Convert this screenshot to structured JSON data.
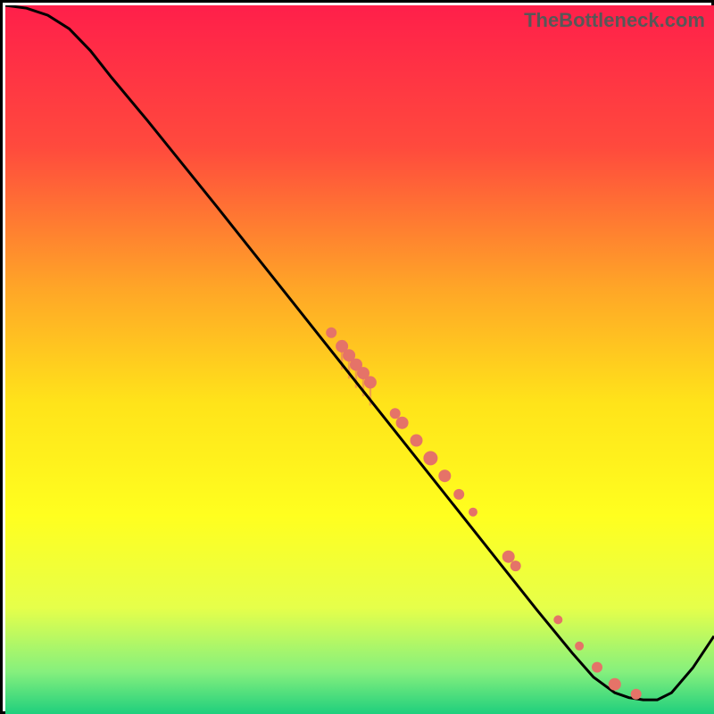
{
  "watermark": "TheBottleneck.com",
  "chart_data": {
    "type": "line",
    "title": "",
    "xlabel": "",
    "ylabel": "",
    "xlim": [
      0,
      100
    ],
    "ylim": [
      0,
      100
    ],
    "gradient_stops": [
      {
        "offset": 0.0,
        "color": "#ff1f4a"
      },
      {
        "offset": 0.2,
        "color": "#ff4a3d"
      },
      {
        "offset": 0.4,
        "color": "#ffa627"
      },
      {
        "offset": 0.56,
        "color": "#ffe31a"
      },
      {
        "offset": 0.72,
        "color": "#ffff1f"
      },
      {
        "offset": 0.85,
        "color": "#e6ff4a"
      },
      {
        "offset": 0.94,
        "color": "#86f07d"
      },
      {
        "offset": 1.0,
        "color": "#1fcf7d"
      }
    ],
    "curve": [
      {
        "x": 0.0,
        "y": 100.0
      },
      {
        "x": 3.0,
        "y": 99.6
      },
      {
        "x": 6.0,
        "y": 98.6
      },
      {
        "x": 9.0,
        "y": 96.7
      },
      {
        "x": 12.0,
        "y": 93.6
      },
      {
        "x": 15.0,
        "y": 89.8
      },
      {
        "x": 20.0,
        "y": 83.8
      },
      {
        "x": 30.0,
        "y": 71.4
      },
      {
        "x": 40.0,
        "y": 58.8
      },
      {
        "x": 50.0,
        "y": 46.2
      },
      {
        "x": 60.0,
        "y": 33.6
      },
      {
        "x": 70.0,
        "y": 21.0
      },
      {
        "x": 75.0,
        "y": 14.7
      },
      {
        "x": 80.0,
        "y": 8.6
      },
      {
        "x": 83.0,
        "y": 5.2
      },
      {
        "x": 86.0,
        "y": 3.0
      },
      {
        "x": 88.0,
        "y": 2.3
      },
      {
        "x": 90.0,
        "y": 2.0
      },
      {
        "x": 92.0,
        "y": 2.0
      },
      {
        "x": 94.0,
        "y": 3.0
      },
      {
        "x": 97.0,
        "y": 6.5
      },
      {
        "x": 100.0,
        "y": 11.0
      }
    ],
    "markers": [
      {
        "x": 46.0,
        "y": 53.8,
        "r": 6
      },
      {
        "x": 47.5,
        "y": 51.9,
        "r": 7
      },
      {
        "x": 48.5,
        "y": 50.6,
        "r": 7
      },
      {
        "x": 49.5,
        "y": 49.3,
        "r": 7
      },
      {
        "x": 50.5,
        "y": 48.1,
        "r": 7
      },
      {
        "x": 51.5,
        "y": 46.8,
        "r": 7
      },
      {
        "x": 55.0,
        "y": 42.4,
        "r": 6
      },
      {
        "x": 56.0,
        "y": 41.1,
        "r": 7
      },
      {
        "x": 58.0,
        "y": 38.6,
        "r": 7
      },
      {
        "x": 60.0,
        "y": 36.1,
        "r": 8
      },
      {
        "x": 62.0,
        "y": 33.6,
        "r": 7
      },
      {
        "x": 64.0,
        "y": 31.0,
        "r": 6
      },
      {
        "x": 66.0,
        "y": 28.5,
        "r": 5
      },
      {
        "x": 71.0,
        "y": 22.2,
        "r": 7
      },
      {
        "x": 72.0,
        "y": 20.9,
        "r": 6
      },
      {
        "x": 78.0,
        "y": 13.3,
        "r": 5
      },
      {
        "x": 81.0,
        "y": 9.6,
        "r": 5
      },
      {
        "x": 83.5,
        "y": 6.6,
        "r": 6
      },
      {
        "x": 86.0,
        "y": 4.2,
        "r": 7
      },
      {
        "x": 89.0,
        "y": 2.8,
        "r": 6
      }
    ],
    "marker_color": "#e57368",
    "curve_color": "#000000"
  }
}
